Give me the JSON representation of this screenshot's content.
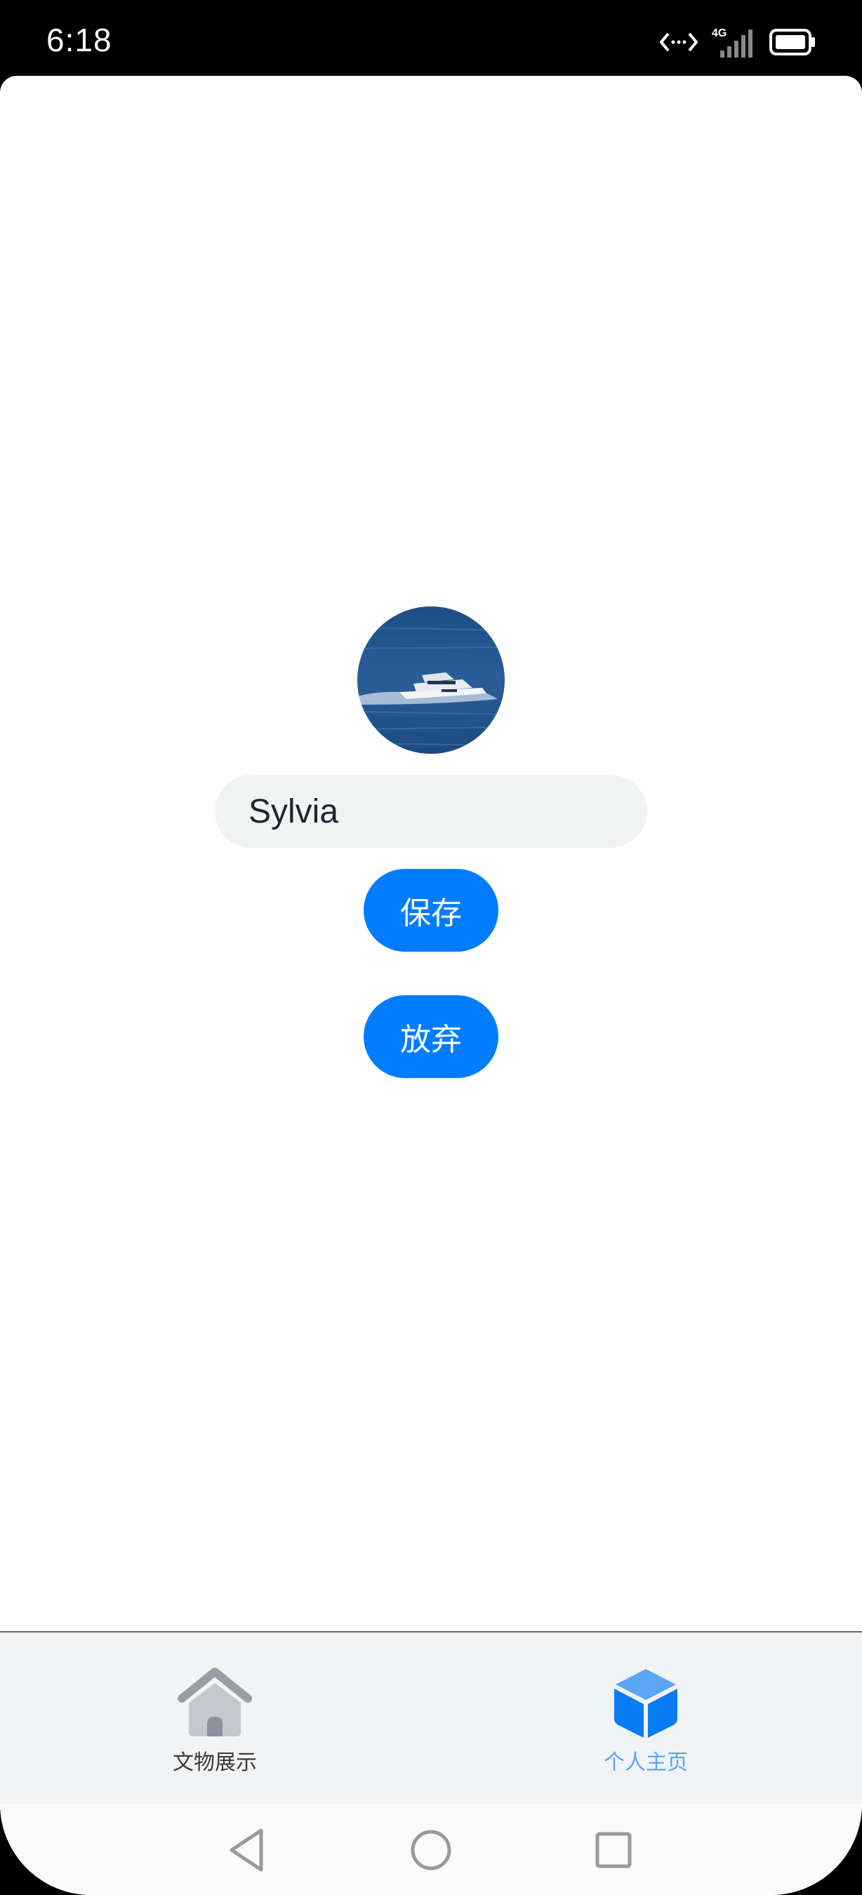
{
  "status_bar": {
    "time": "6:18",
    "network": "4G",
    "icons": [
      "data-transfer-icon",
      "signal-icon",
      "battery-icon"
    ]
  },
  "profile": {
    "avatar": "boat-photo-avatar",
    "name_value": "Sylvia",
    "save_label": "保存",
    "discard_label": "放弃"
  },
  "tab_bar": {
    "items": [
      {
        "label": "文物展示",
        "icon": "home-icon",
        "active": false
      },
      {
        "label": "个人主页",
        "icon": "cube-icon",
        "active": true
      }
    ]
  },
  "nav_bar": {
    "icons": [
      "back-triangle-icon",
      "home-circle-icon",
      "recents-square-icon"
    ]
  },
  "colors": {
    "accent": "#007dfe",
    "tab_active": "#5aa5f5",
    "input_bg": "#f1f3f3",
    "tab_bar_bg": "#f1f3f5"
  }
}
